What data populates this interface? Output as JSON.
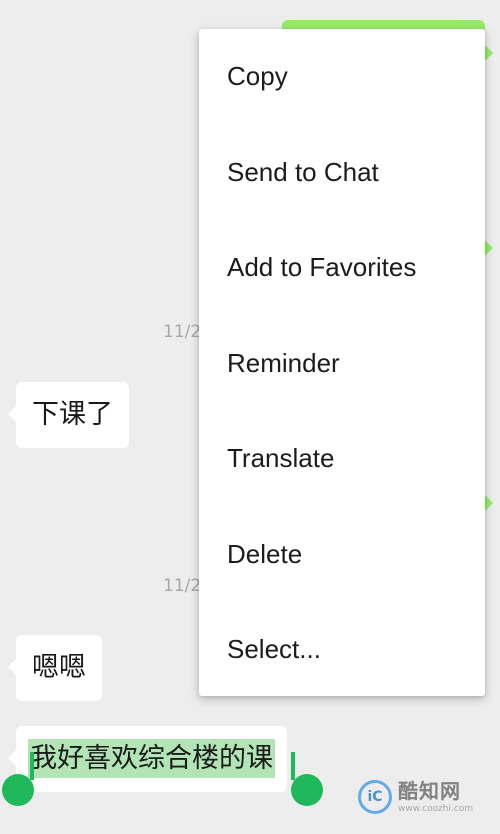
{
  "chat": {
    "timestamps": [
      "11/2",
      "11/2"
    ],
    "messages_incoming": [
      {
        "text": "下课了"
      },
      {
        "text": "嗯嗯"
      },
      {
        "text": "我好喜欢综合楼的课"
      }
    ]
  },
  "context_menu": {
    "items": [
      {
        "label": "Copy"
      },
      {
        "label": "Send to Chat"
      },
      {
        "label": "Add to Favorites"
      },
      {
        "label": "Reminder"
      },
      {
        "label": "Translate"
      },
      {
        "label": "Delete"
      },
      {
        "label": "Select..."
      }
    ]
  },
  "watermark": {
    "logo_letters": "iC",
    "name": "酷知网",
    "url": "www.coozhi.com"
  },
  "colors": {
    "background": "#ededed",
    "outgoing_bubble": "#95ec69",
    "selection_highlight": "#b2e4b6",
    "selection_handle": "#1fb85a",
    "menu_bg": "#ffffff"
  }
}
